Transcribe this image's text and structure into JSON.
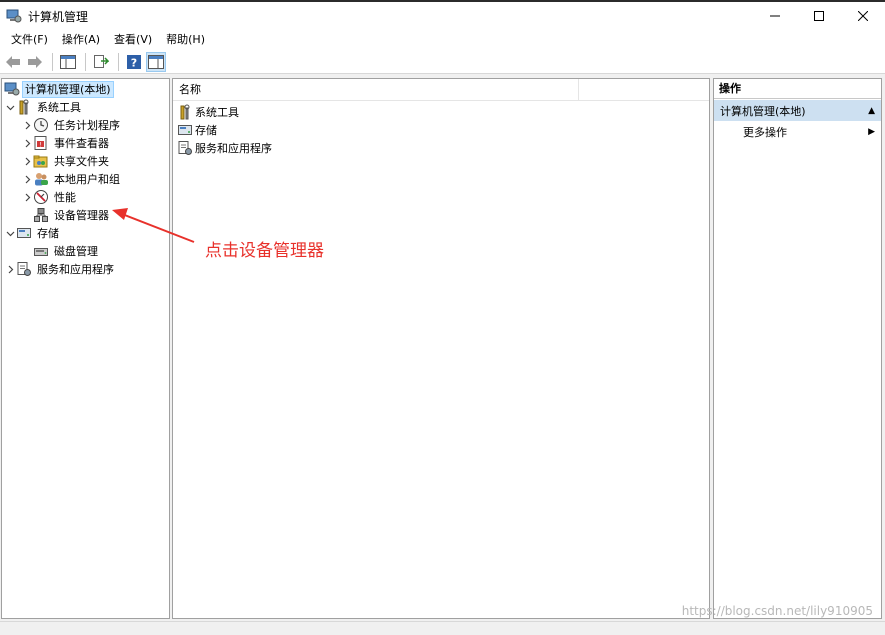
{
  "window": {
    "title": "计算机管理",
    "controls": {
      "minimize": "—",
      "maximize": "☐",
      "close": "✕"
    }
  },
  "menubar": {
    "items": [
      "文件(F)",
      "操作(A)",
      "查看(V)",
      "帮助(H)"
    ]
  },
  "toolbar": {
    "icons": [
      "back-arrow-icon",
      "forward-arrow-icon",
      "show-hide-tree-icon",
      "export-list-icon",
      "help-icon",
      "show-hide-action-pane-icon"
    ]
  },
  "tree": {
    "items": [
      {
        "label": "计算机管理(本地)",
        "icon": "computer-management-icon",
        "level": 0,
        "expander": "",
        "selected": true
      },
      {
        "label": "系统工具",
        "icon": "system-tools-icon",
        "level": 0,
        "expander": "v"
      },
      {
        "label": "任务计划程序",
        "icon": "task-scheduler-icon",
        "level": 1,
        "expander": ">"
      },
      {
        "label": "事件查看器",
        "icon": "event-viewer-icon",
        "level": 1,
        "expander": ">"
      },
      {
        "label": "共享文件夹",
        "icon": "shared-folders-icon",
        "level": 1,
        "expander": ">"
      },
      {
        "label": "本地用户和组",
        "icon": "local-users-icon",
        "level": 1,
        "expander": ">"
      },
      {
        "label": "性能",
        "icon": "performance-icon",
        "level": 1,
        "expander": ">"
      },
      {
        "label": "设备管理器",
        "icon": "device-manager-icon",
        "level": 1,
        "expander": ""
      },
      {
        "label": "存储",
        "icon": "storage-icon",
        "level": 0,
        "expander": "v"
      },
      {
        "label": "磁盘管理",
        "icon": "disk-management-icon",
        "level": 1,
        "expander": ""
      },
      {
        "label": "服务和应用程序",
        "icon": "services-apps-icon",
        "level": 0,
        "expander": ">"
      }
    ]
  },
  "list": {
    "columns": [
      "名称",
      ""
    ],
    "rows": [
      {
        "label": "系统工具",
        "icon": "system-tools-icon"
      },
      {
        "label": "存储",
        "icon": "storage-icon"
      },
      {
        "label": "服务和应用程序",
        "icon": "services-apps-icon"
      }
    ]
  },
  "actions": {
    "header": "操作",
    "section": "计算机管理(本地)",
    "section_arrow": "▲",
    "item": "更多操作",
    "item_arrow": "▶"
  },
  "annotation": {
    "text": "点击设备管理器",
    "color": "#e8312b"
  },
  "watermark": "https://blog.csdn.net/lily910905",
  "colors": {
    "selection": "#cce8ff",
    "action_section": "#cde0f1"
  }
}
